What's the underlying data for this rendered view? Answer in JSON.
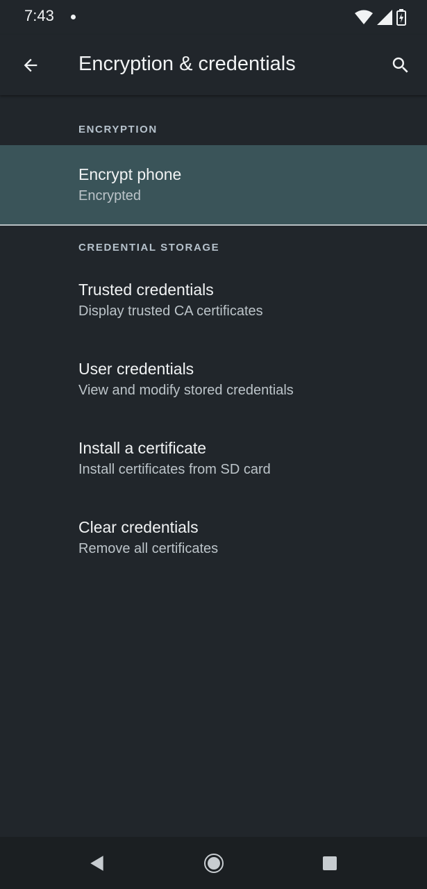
{
  "status": {
    "time": "7:43",
    "icons": [
      "notification-dot-icon",
      "wifi-icon",
      "cell-signal-icon",
      "battery-icon"
    ]
  },
  "appbar": {
    "title": "Encryption & credentials",
    "back_icon": "back-arrow-icon",
    "search_icon": "search-icon"
  },
  "sections": [
    {
      "header": "ENCRYPTION",
      "items": [
        {
          "title": "Encrypt phone",
          "summary": "Encrypted",
          "highlighted": true
        }
      ]
    },
    {
      "header": "CREDENTIAL STORAGE",
      "items": [
        {
          "title": "Trusted credentials",
          "summary": "Display trusted CA certificates"
        },
        {
          "title": "User credentials",
          "summary": "View and modify stored credentials"
        },
        {
          "title": "Install a certificate",
          "summary": "Install certificates from SD card"
        },
        {
          "title": "Clear credentials",
          "summary": "Remove all certificates"
        }
      ]
    }
  ],
  "navbar": {
    "icons": [
      "nav-back-icon",
      "nav-home-icon",
      "nav-recents-icon"
    ]
  },
  "colors": {
    "background": "#21262b",
    "highlight": "#3a5459",
    "section_header": "#b6c2cc"
  }
}
